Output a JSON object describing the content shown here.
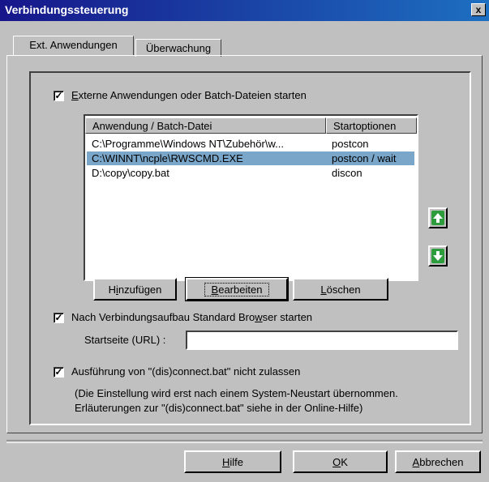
{
  "window": {
    "title": "Verbindungssteuerung",
    "close_label": "x"
  },
  "tabs": [
    {
      "label": "Ext. Anwendungen",
      "active": true
    },
    {
      "label": "Überwachung",
      "active": false
    }
  ],
  "external": {
    "checked": true,
    "label_first": "E",
    "label_rest": "xterne Anwendungen oder Batch-Dateien starten"
  },
  "list": {
    "columns": [
      "Anwendung / Batch-Datei",
      "Startoptionen"
    ],
    "rows": [
      {
        "app": "C:\\Programme\\Windows NT\\Zubehör\\w...",
        "options": "postcon"
      },
      {
        "app": "C:\\WINNT\\ncple\\RWSCMD.EXE",
        "options": "postcon / wait",
        "selected": true
      },
      {
        "app": "D:\\copy\\copy.bat",
        "options": "discon"
      }
    ]
  },
  "buttons": {
    "add_a": "H",
    "add_u": "i",
    "add_b": "nzufügen",
    "edit_u": "B",
    "edit_b": "earbeiten",
    "delete_u": "L",
    "delete_b": "öschen"
  },
  "browser": {
    "checked": true,
    "label_a": "Nach Verbindungsaufbau Standard Bro",
    "label_u": "w",
    "label_b": "ser starten",
    "url_label": "Startseite (URL) :",
    "url_value": ""
  },
  "connect": {
    "checked": true,
    "label": "Ausführung von \"(dis)connect.bat\" nicht zulassen",
    "note_line1": "(Die Einstellung wird erst nach einem System-Neustart übernommen.",
    "note_line2": "Erläuterungen zur \"(dis)connect.bat\" siehe in der Online-Hilfe)"
  },
  "footer": {
    "help_u": "H",
    "help_b": "ilfe",
    "ok_u": "O",
    "ok_b": "K",
    "cancel_u": "A",
    "cancel_b": "bbrechen"
  },
  "colors": {
    "title_start": "#17168a",
    "title_end": "#1d6fc1",
    "selection": "#7aa6c9",
    "arrow_icon": "#2c9c3c"
  },
  "icons": {
    "move_up": "arrow-up-icon",
    "move_down": "arrow-down-icon"
  }
}
